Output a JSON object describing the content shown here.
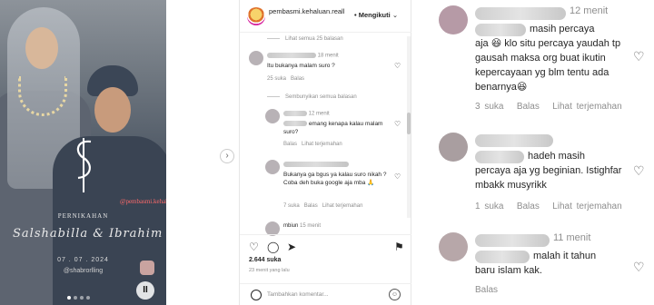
{
  "photo": {
    "watermark": "@pembasmi.kehaluan.reall",
    "title": "PERNIKAHAN",
    "names": "Salshabilla & Ibrahim",
    "date": "07 . 07 . 2024",
    "handle": "@shabrorlling"
  },
  "post": {
    "username": "pembasmi.kehaluan.reall",
    "follow_label": "Mengikuti",
    "view_replies_1": "Lihat semua 25 balasan",
    "comment1": {
      "time": "18 menit",
      "text": "Itu bukanya malam suro ?",
      "likes": "25 suka",
      "reply": "Balas"
    },
    "hide_replies": "Sembunyikan semua balasan",
    "reply1": {
      "time": "12 menit",
      "text": "emang kenapa kalau malam suro?",
      "reply": "Balas",
      "translate": "Lihat terjemahan"
    },
    "reply2": {
      "text": "Bukanya ga bgus ya kalau suro nikah ? Coba deh buka google aja mba 🙏",
      "likes": "7 suka",
      "reply": "Balas",
      "translate": "Lihat terjemahan"
    },
    "reply3": {
      "name": "mbiun",
      "time": "15 menit"
    },
    "likes": "2.644 suka",
    "ago": "23 menit yang lalu",
    "comment_placeholder": "Tambahkan komentar..."
  },
  "zoom": {
    "c1": {
      "time": "12 menit",
      "text_a": "masih percaya",
      "text_b": "aja 😆 klo situ percaya yaudah tp gausah maksa org buat ikutin kepercayaan yg blm tentu ada benarnya😆",
      "likes": "3 suka",
      "reply": "Balas",
      "translate": "Lihat terjemahan"
    },
    "c2": {
      "text_a": "hadeh masih",
      "text_b": "percaya aja yg beginian. Istighfar mbakk musyrikk",
      "likes": "1 suka",
      "reply": "Balas",
      "translate": "Lihat terjemahan"
    },
    "c3": {
      "time": "11 menit",
      "text_a": "malah it tahun",
      "text_b": "baru islam kak.",
      "reply": "Balas"
    }
  }
}
